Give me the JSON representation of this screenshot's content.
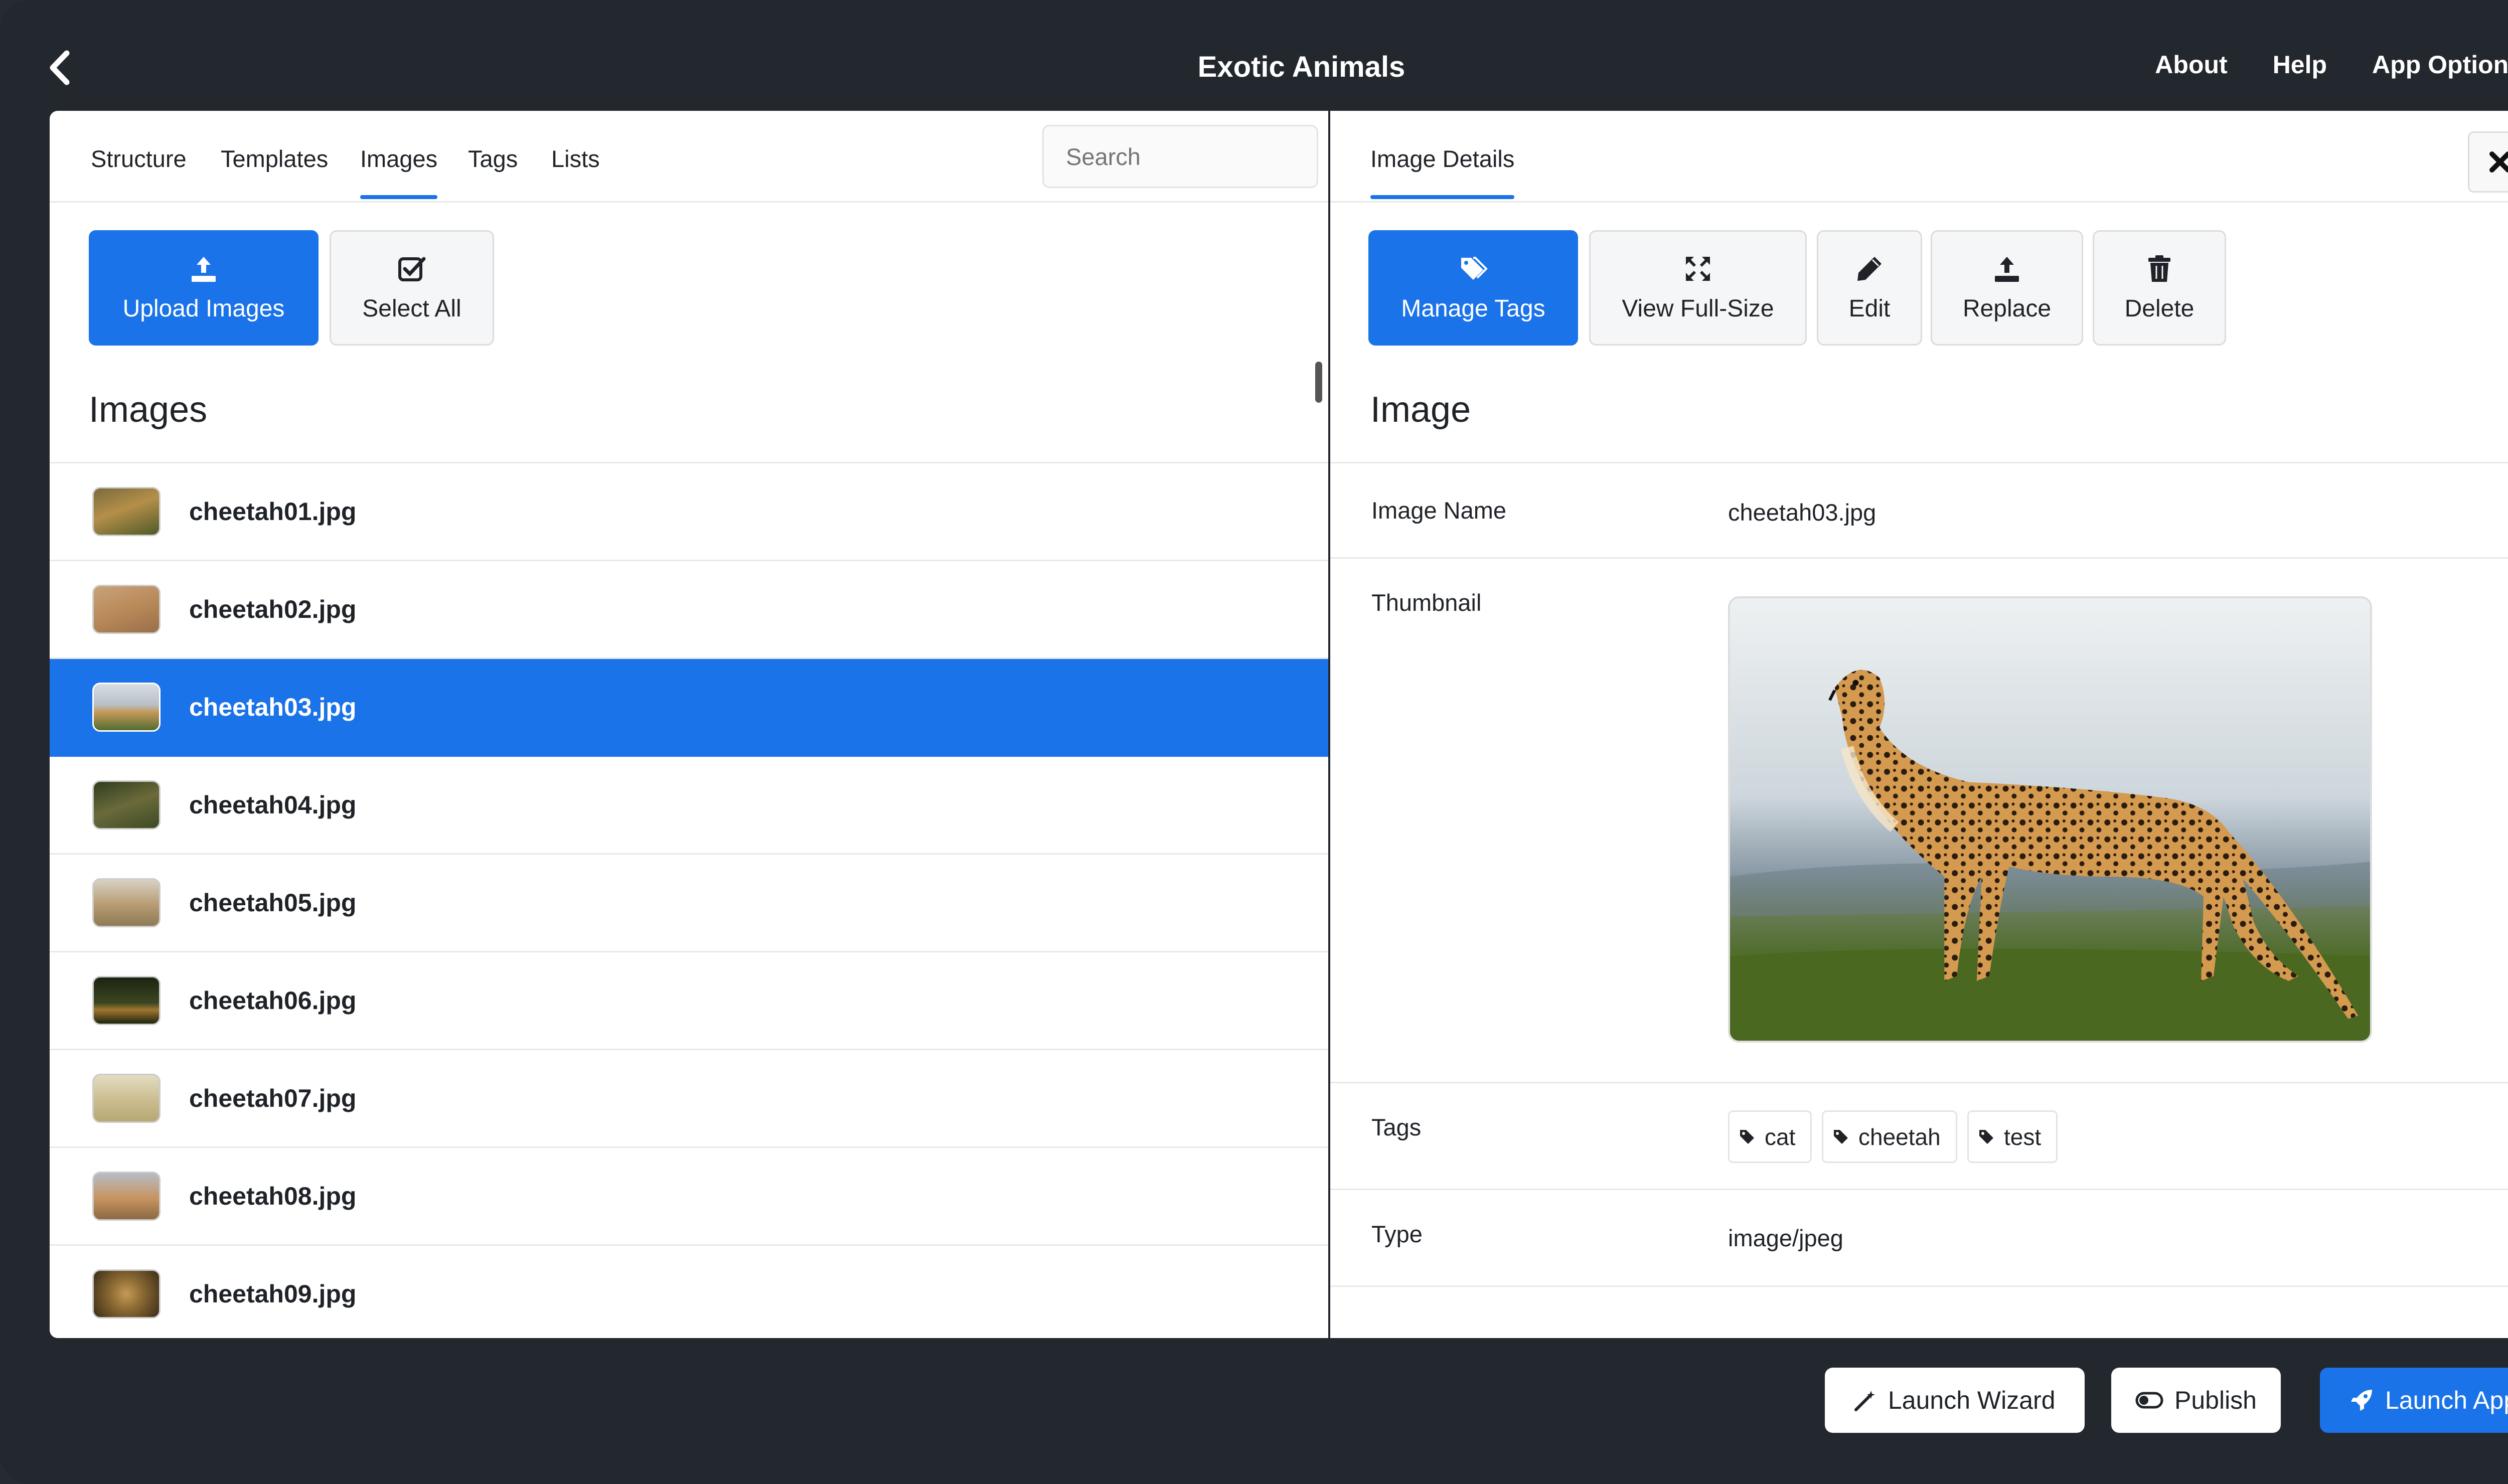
{
  "app": {
    "title": "Exotic Animals"
  },
  "topnav": {
    "about": "About",
    "help": "Help",
    "app_options": "App Options"
  },
  "left": {
    "tabs": [
      "Structure",
      "Templates",
      "Images",
      "Tags",
      "Lists"
    ],
    "active_tab": "Images",
    "search_placeholder": "Search",
    "buttons": {
      "upload": "Upload Images",
      "select_all": "Select All"
    },
    "section_title": "Images",
    "images": [
      {
        "name": "cheetah01.jpg",
        "selected": false
      },
      {
        "name": "cheetah02.jpg",
        "selected": false
      },
      {
        "name": "cheetah03.jpg",
        "selected": true
      },
      {
        "name": "cheetah04.jpg",
        "selected": false
      },
      {
        "name": "cheetah05.jpg",
        "selected": false
      },
      {
        "name": "cheetah06.jpg",
        "selected": false
      },
      {
        "name": "cheetah07.jpg",
        "selected": false
      },
      {
        "name": "cheetah08.jpg",
        "selected": false
      },
      {
        "name": "cheetah09.jpg",
        "selected": false
      }
    ]
  },
  "right": {
    "tab": "Image Details",
    "buttons": {
      "manage_tags": "Manage Tags",
      "view_full": "View Full-Size",
      "edit": "Edit",
      "replace": "Replace",
      "delete": "Delete"
    },
    "section_title": "Image",
    "fields": {
      "name_label": "Image Name",
      "name_value": "cheetah03.jpg",
      "thumb_label": "Thumbnail",
      "tags_label": "Tags",
      "tags": [
        "cat",
        "cheetah",
        "test"
      ],
      "type_label": "Type",
      "type_value": "image/jpeg"
    }
  },
  "bottom": {
    "launch_wizard": "Launch Wizard",
    "publish": "Publish",
    "launch_app": "Launch App"
  },
  "colors": {
    "accent": "#1a73e8",
    "chrome": "#23282e"
  }
}
